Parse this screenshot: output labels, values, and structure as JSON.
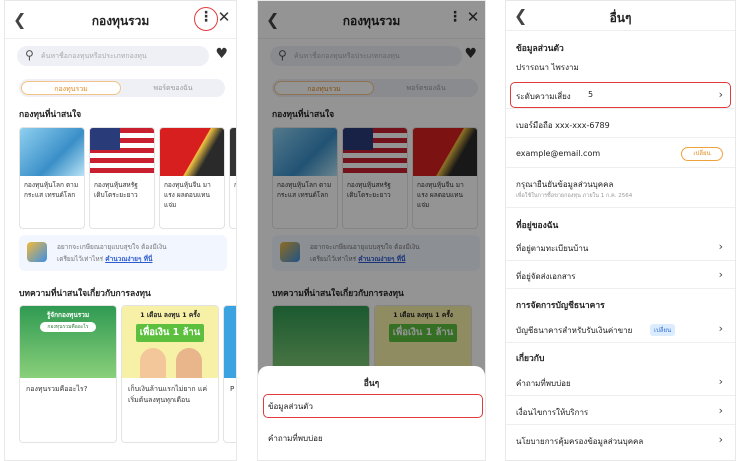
{
  "fund_screen": {
    "title": "กองทุนรวม",
    "search_placeholder": "ค้นหาชื่อกองทุนหรือประเภทกองทุน",
    "tabs": [
      "กองทุนรวม",
      "พอร์ตของฉัน"
    ],
    "featured_title": "กองทุนที่น่าสนใจ",
    "featured_cards": [
      {
        "label": "กองทุนหุ้นโลก ตามกระแส เทรนด์โลก"
      },
      {
        "label": "กองทุนหุ้นสหรัฐ เติบโตระยะยาว"
      },
      {
        "label": "กองทุนหุ้นจีน มาแรง ผลตอบแทนแจ่ม"
      },
      {
        "label": "ก พ"
      }
    ],
    "banner": {
      "line1": "อยากจะเกษียณอายุแบบสุขใจ ต้องมีเงิน",
      "line2_prefix": "เตรียมไว้เท่าไหร่",
      "link": "คำนวณง่ายๆ ที่นี่"
    },
    "articles_title": "บทความที่น่าสนใจเกี่ยวกับการลงทุน",
    "articles": [
      {
        "caption": "รู้จักกองทุนรวม",
        "pill": "กองทุนรวมคืออะไร",
        "label": "กองทุนรวมคืออะไร?"
      },
      {
        "caption": "1 เดือน ลงทุน 1 ครั้ง",
        "big": "เพื่อเงิน 1 ล้าน",
        "label": "เก็บเงินล้านแรกไม่ยาก แค่เริ่มต้นลงทุนทุกเดือน"
      },
      {
        "caption": "",
        "big": "",
        "label": "P ก ส ท"
      }
    ]
  },
  "sheet": {
    "title": "อื่นๆ",
    "items": [
      "ข้อมูลส่วนตัว",
      "คำถามที่พบบ่อย"
    ]
  },
  "other_screen": {
    "title": "อื่นๆ",
    "personal_header": "ข้อมูลส่วนตัว",
    "name": "ปรารถนา ไพรงาม",
    "risk_label": "ระดับความเสี่ยง",
    "risk_value": "5",
    "phone": "เบอร์มือถือ xxx-xxx-6789",
    "email": "example@email.com",
    "email_button": "เปลี่ยน",
    "confirm_title": "กรุณายืนยันข้อมูลส่วนบุคคล",
    "confirm_sub": "เพื่อใช้ในการซื้อขายกองทุน ภายใน 1 ก.ค. 2564",
    "address_header": "ที่อยู่ของฉัน",
    "address_items": [
      "ที่อยู่ตามทะเบียนบ้าน",
      "ที่อยู่จัดส่งเอกสาร"
    ],
    "bank_header": "การจัดการบัญชีธนาคาร",
    "bank_item": "บัญชีธนาคารสำหรับรับเงินค่าขาย",
    "bank_badge": "เปลี่ยน",
    "about_header": "เกี่ยวกับ",
    "about_items": [
      "คำถามที่พบบ่อย",
      "เงื่อนไขการให้บริการ",
      "นโยบายการคุ้มครองข้อมูลส่วนบุคคล"
    ]
  },
  "icons": {
    "back": "chevron-left-icon",
    "more": "vertical-dots-icon",
    "close": "close-icon",
    "search": "search-icon",
    "favorite": "heart-icon",
    "chevron": "chevron-right-icon"
  },
  "colors": {
    "accent_orange": "#e08a1e",
    "highlight_red": "#e23b3b",
    "link_blue": "#2d5bd1"
  }
}
